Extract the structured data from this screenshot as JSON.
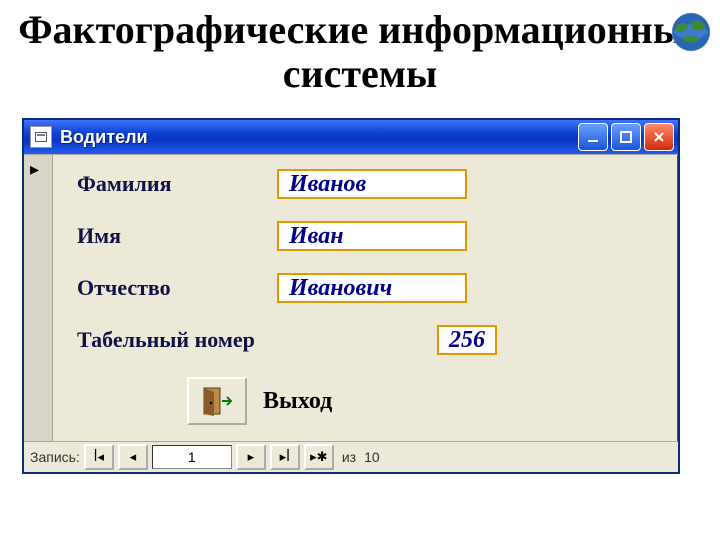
{
  "heading": "Фактографические информационные системы",
  "window": {
    "title": "Водители",
    "fields": {
      "surname_label": "Фамилия",
      "surname_value": "Иванов",
      "name_label": "Имя",
      "name_value": "Иван",
      "patronymic_label": "Отчество",
      "patronymic_value": "Иванович",
      "empno_label": "Табельный номер",
      "empno_value": "256"
    },
    "exit_label": "Выход"
  },
  "nav": {
    "record_label": "Запись:",
    "current": "1",
    "of_label": "из",
    "total": "10"
  }
}
